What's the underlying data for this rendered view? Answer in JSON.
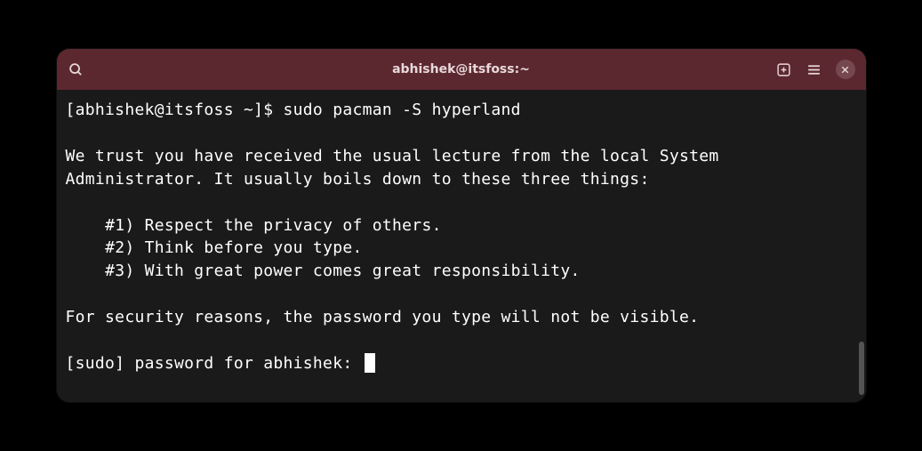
{
  "titlebar": {
    "title": "abhishek@itsfoss:~"
  },
  "terminal": {
    "prompt": "[abhishek@itsfoss ~]$ ",
    "command": "sudo pacman -S hyperland",
    "lecture_intro": "We trust you have received the usual lecture from the local System\nAdministrator. It usually boils down to these three things:",
    "lecture_item1": "    #1) Respect the privacy of others.",
    "lecture_item2": "    #2) Think before you type.",
    "lecture_item3": "    #3) With great power comes great responsibility.",
    "security_note": "For security reasons, the password you type will not be visible.",
    "password_prompt": "[sudo] password for abhishek: "
  }
}
